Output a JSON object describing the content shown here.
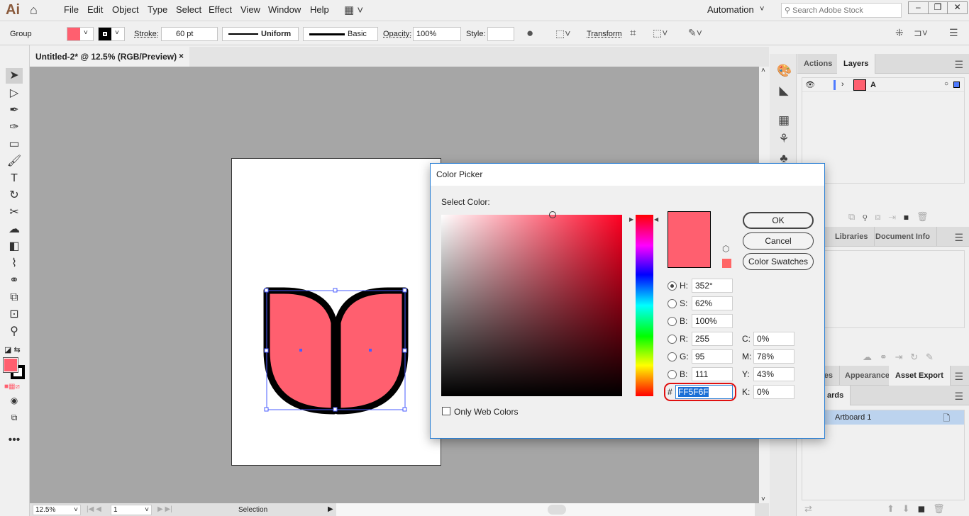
{
  "app": {
    "logo": "Ai",
    "menus": [
      "File",
      "Edit",
      "Object",
      "Type",
      "Select",
      "Effect",
      "View",
      "Window",
      "Help"
    ],
    "workspace": "Automation",
    "search_placeholder": "Search Adobe Stock"
  },
  "control": {
    "selection": "Group",
    "fill_color": "#FF5F6F",
    "stroke_label": "Stroke:",
    "stroke_weight": "60 pt",
    "profile": "Uniform",
    "brush": "Basic",
    "opacity_label": "Opacity:",
    "opacity": "100%",
    "style_label": "Style:",
    "transform_label": "Transform"
  },
  "document": {
    "tab_title": "Untitled-2* @ 12.5% (RGB/Preview)",
    "close": "×"
  },
  "status": {
    "zoom": "12.5%",
    "artboard_num": "1",
    "tool": "Selection"
  },
  "layers_panel": {
    "tabs": [
      "Actions",
      "Layers"
    ],
    "active": "Layers",
    "layers": [
      {
        "name": "A",
        "color": "#4f7bff"
      }
    ]
  },
  "libraries_panel": {
    "tabs": [
      "Libraries",
      "Document Info"
    ]
  },
  "asset_panel": {
    "tabs": [
      "bles",
      "Appearance",
      "Asset Export"
    ],
    "active": "Asset Export"
  },
  "artboards_panel": {
    "tab": "ards",
    "items": [
      "Artboard 1"
    ]
  },
  "color_picker": {
    "title": "Color Picker",
    "select_label": "Select Color:",
    "ok": "OK",
    "cancel": "Cancel",
    "swatches": "Color Swatches",
    "new_color": "#FF5F6F",
    "web_safe_color": "#FF6666",
    "hsb": [
      {
        "label": "H:",
        "value": "352°",
        "selected": true
      },
      {
        "label": "S:",
        "value": "62%"
      },
      {
        "label": "B:",
        "value": "100%"
      }
    ],
    "rgb": [
      {
        "label": "R:",
        "value": "255"
      },
      {
        "label": "G:",
        "value": "95"
      },
      {
        "label": "B:",
        "value": "111"
      }
    ],
    "cmyk": [
      {
        "label": "C:",
        "value": "0%"
      },
      {
        "label": "M:",
        "value": "78%"
      },
      {
        "label": "Y:",
        "value": "43%"
      },
      {
        "label": "K:",
        "value": "0%"
      }
    ],
    "hex_label": "#",
    "hex": "FF5F6F",
    "only_web_colors": "Only Web Colors",
    "only_web_checked": false
  }
}
